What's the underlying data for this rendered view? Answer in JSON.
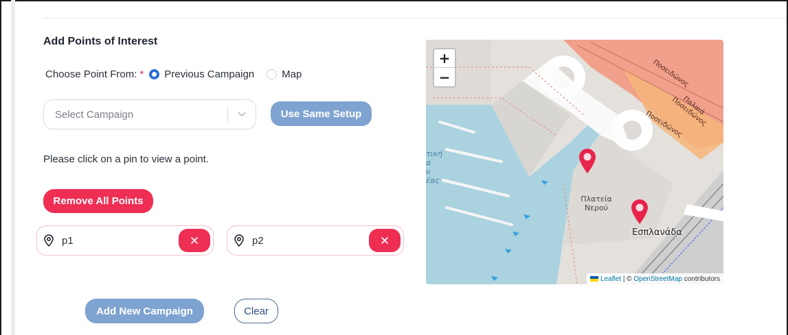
{
  "form": {
    "title": "Add Points of Interest",
    "choose_label": "Choose Point From:",
    "required_mark": "*",
    "radio_options": [
      {
        "label": "Previous Campaign",
        "checked": true
      },
      {
        "label": "Map",
        "checked": false
      }
    ],
    "select_placeholder": "Select Campaign",
    "use_same_setup_label": "Use Same Setup",
    "help_text": "Please click on a pin to view a point.",
    "remove_all_label": "Remove All Points",
    "points": [
      {
        "label": "p1",
        "icon": "map-pin-icon"
      },
      {
        "label": "p2",
        "icon": "map-pin-icon"
      }
    ],
    "add_campaign_label": "Add New Campaign",
    "clear_label": "Clear"
  },
  "map": {
    "zoom_in": "+",
    "zoom_out": "−",
    "labels": {
      "square": "Πλατεία Νερού",
      "esplanade": "Εσπλανάδα",
      "street_1": "Ποσειδώνος",
      "street_2": "Ποσειδώνος",
      "street_3": "Παλαιά Ποσειδώνος",
      "sea": "τική\nα\nυ\nέας"
    },
    "attribution": {
      "leaflet": "Leaflet",
      "separator": " | © ",
      "osm": "OpenStreetMap",
      "suffix": " contributors"
    }
  },
  "colors": {
    "accent_blue": "#7fa3d1",
    "danger_red": "#ef2e54",
    "radio_blue": "#2d6cd6",
    "required_red": "#e8244b"
  }
}
